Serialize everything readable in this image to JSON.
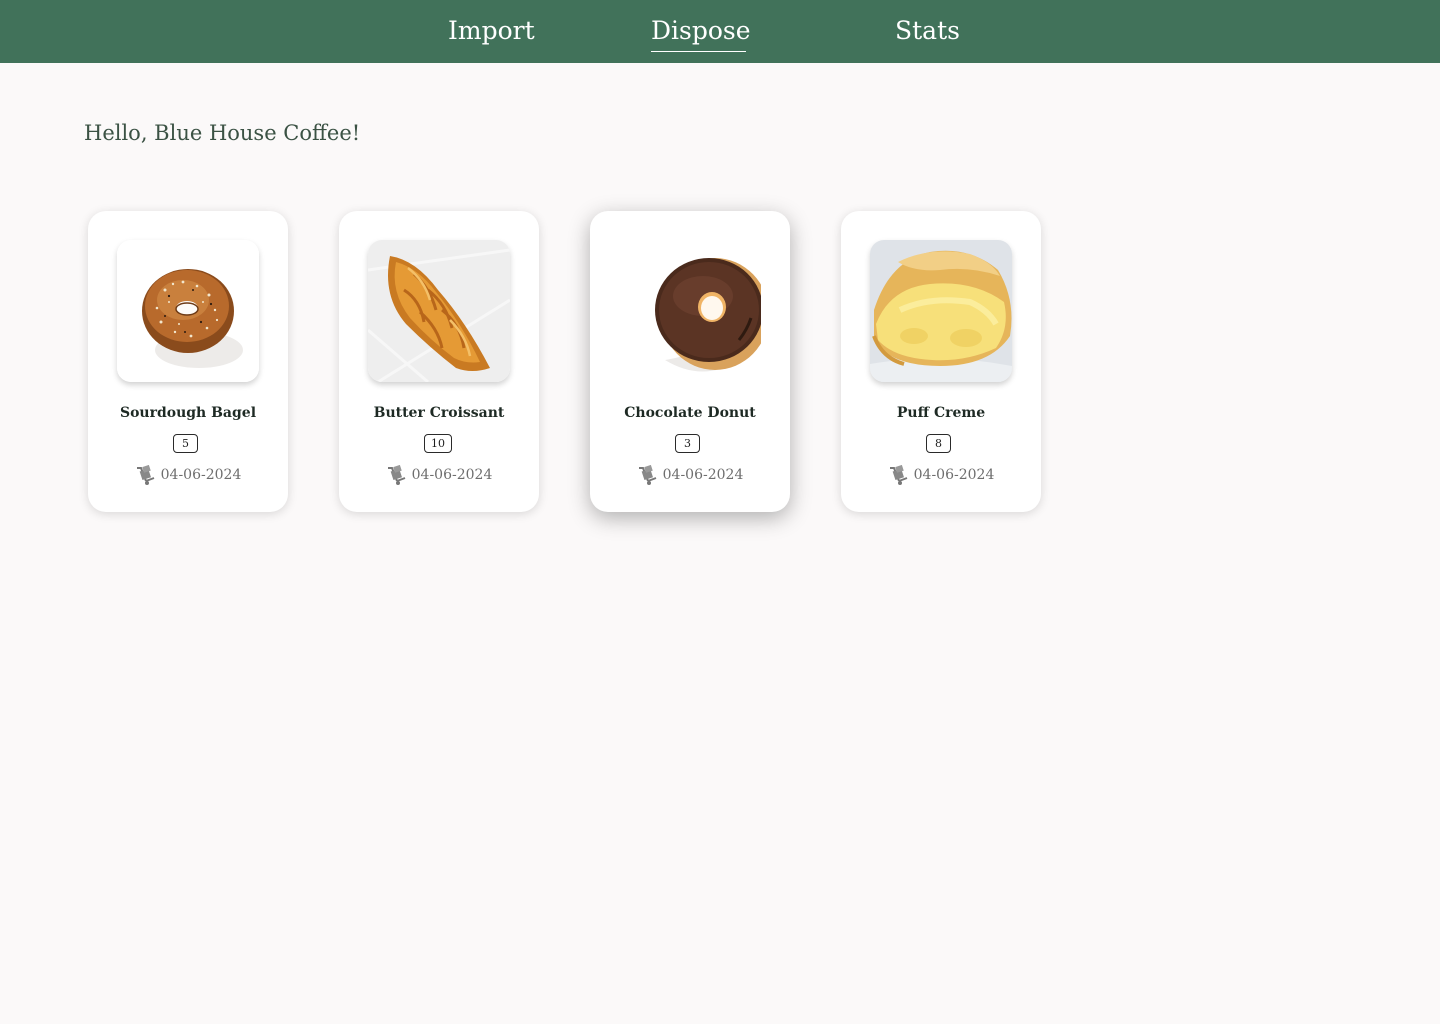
{
  "nav": {
    "items": [
      {
        "label": "Import",
        "active": false
      },
      {
        "label": "Dispose",
        "active": true
      },
      {
        "label": "Stats",
        "active": false
      }
    ]
  },
  "greeting": "Hello, Blue House Coffee!",
  "products": [
    {
      "name": "Sourdough Bagel",
      "quantity": "5",
      "date": "04-06-2024",
      "image_icon": "bagel-image"
    },
    {
      "name": "Butter Croissant",
      "quantity": "10",
      "date": "04-06-2024",
      "image_icon": "croissant-image"
    },
    {
      "name": "Chocolate Donut",
      "quantity": "3",
      "date": "04-06-2024",
      "image_icon": "donut-image"
    },
    {
      "name": "Puff Creme",
      "quantity": "8",
      "date": "04-06-2024",
      "image_icon": "cream-puff-image"
    }
  ],
  "date_icon": "hand-truck-icon",
  "colors": {
    "header": "#41725a",
    "background": "#fbf9f9",
    "greeting_text": "#3b5244",
    "card": "#ffffff"
  }
}
